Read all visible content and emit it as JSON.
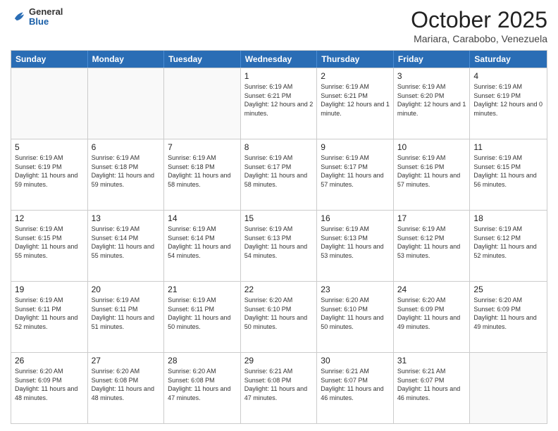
{
  "logo": {
    "general": "General",
    "blue": "Blue"
  },
  "header": {
    "month": "October 2025",
    "location": "Mariara, Carabobo, Venezuela"
  },
  "days": [
    "Sunday",
    "Monday",
    "Tuesday",
    "Wednesday",
    "Thursday",
    "Friday",
    "Saturday"
  ],
  "weeks": [
    [
      {
        "day": "",
        "empty": true
      },
      {
        "day": "",
        "empty": true
      },
      {
        "day": "",
        "empty": true
      },
      {
        "day": "1",
        "sunrise": "6:19 AM",
        "sunset": "6:21 PM",
        "daylight": "12 hours and 2 minutes."
      },
      {
        "day": "2",
        "sunrise": "6:19 AM",
        "sunset": "6:21 PM",
        "daylight": "12 hours and 1 minute."
      },
      {
        "day": "3",
        "sunrise": "6:19 AM",
        "sunset": "6:20 PM",
        "daylight": "12 hours and 1 minute."
      },
      {
        "day": "4",
        "sunrise": "6:19 AM",
        "sunset": "6:19 PM",
        "daylight": "12 hours and 0 minutes."
      }
    ],
    [
      {
        "day": "5",
        "sunrise": "6:19 AM",
        "sunset": "6:19 PM",
        "daylight": "11 hours and 59 minutes."
      },
      {
        "day": "6",
        "sunrise": "6:19 AM",
        "sunset": "6:18 PM",
        "daylight": "11 hours and 59 minutes."
      },
      {
        "day": "7",
        "sunrise": "6:19 AM",
        "sunset": "6:18 PM",
        "daylight": "11 hours and 58 minutes."
      },
      {
        "day": "8",
        "sunrise": "6:19 AM",
        "sunset": "6:17 PM",
        "daylight": "11 hours and 58 minutes."
      },
      {
        "day": "9",
        "sunrise": "6:19 AM",
        "sunset": "6:17 PM",
        "daylight": "11 hours and 57 minutes."
      },
      {
        "day": "10",
        "sunrise": "6:19 AM",
        "sunset": "6:16 PM",
        "daylight": "11 hours and 57 minutes."
      },
      {
        "day": "11",
        "sunrise": "6:19 AM",
        "sunset": "6:15 PM",
        "daylight": "11 hours and 56 minutes."
      }
    ],
    [
      {
        "day": "12",
        "sunrise": "6:19 AM",
        "sunset": "6:15 PM",
        "daylight": "11 hours and 55 minutes."
      },
      {
        "day": "13",
        "sunrise": "6:19 AM",
        "sunset": "6:14 PM",
        "daylight": "11 hours and 55 minutes."
      },
      {
        "day": "14",
        "sunrise": "6:19 AM",
        "sunset": "6:14 PM",
        "daylight": "11 hours and 54 minutes."
      },
      {
        "day": "15",
        "sunrise": "6:19 AM",
        "sunset": "6:13 PM",
        "daylight": "11 hours and 54 minutes."
      },
      {
        "day": "16",
        "sunrise": "6:19 AM",
        "sunset": "6:13 PM",
        "daylight": "11 hours and 53 minutes."
      },
      {
        "day": "17",
        "sunrise": "6:19 AM",
        "sunset": "6:12 PM",
        "daylight": "11 hours and 53 minutes."
      },
      {
        "day": "18",
        "sunrise": "6:19 AM",
        "sunset": "6:12 PM",
        "daylight": "11 hours and 52 minutes."
      }
    ],
    [
      {
        "day": "19",
        "sunrise": "6:19 AM",
        "sunset": "6:11 PM",
        "daylight": "11 hours and 52 minutes."
      },
      {
        "day": "20",
        "sunrise": "6:19 AM",
        "sunset": "6:11 PM",
        "daylight": "11 hours and 51 minutes."
      },
      {
        "day": "21",
        "sunrise": "6:19 AM",
        "sunset": "6:11 PM",
        "daylight": "11 hours and 50 minutes."
      },
      {
        "day": "22",
        "sunrise": "6:20 AM",
        "sunset": "6:10 PM",
        "daylight": "11 hours and 50 minutes."
      },
      {
        "day": "23",
        "sunrise": "6:20 AM",
        "sunset": "6:10 PM",
        "daylight": "11 hours and 50 minutes."
      },
      {
        "day": "24",
        "sunrise": "6:20 AM",
        "sunset": "6:09 PM",
        "daylight": "11 hours and 49 minutes."
      },
      {
        "day": "25",
        "sunrise": "6:20 AM",
        "sunset": "6:09 PM",
        "daylight": "11 hours and 49 minutes."
      }
    ],
    [
      {
        "day": "26",
        "sunrise": "6:20 AM",
        "sunset": "6:09 PM",
        "daylight": "11 hours and 48 minutes."
      },
      {
        "day": "27",
        "sunrise": "6:20 AM",
        "sunset": "6:08 PM",
        "daylight": "11 hours and 48 minutes."
      },
      {
        "day": "28",
        "sunrise": "6:20 AM",
        "sunset": "6:08 PM",
        "daylight": "11 hours and 47 minutes."
      },
      {
        "day": "29",
        "sunrise": "6:21 AM",
        "sunset": "6:08 PM",
        "daylight": "11 hours and 47 minutes."
      },
      {
        "day": "30",
        "sunrise": "6:21 AM",
        "sunset": "6:07 PM",
        "daylight": "11 hours and 46 minutes."
      },
      {
        "day": "31",
        "sunrise": "6:21 AM",
        "sunset": "6:07 PM",
        "daylight": "11 hours and 46 minutes."
      },
      {
        "day": "",
        "empty": true
      }
    ]
  ]
}
